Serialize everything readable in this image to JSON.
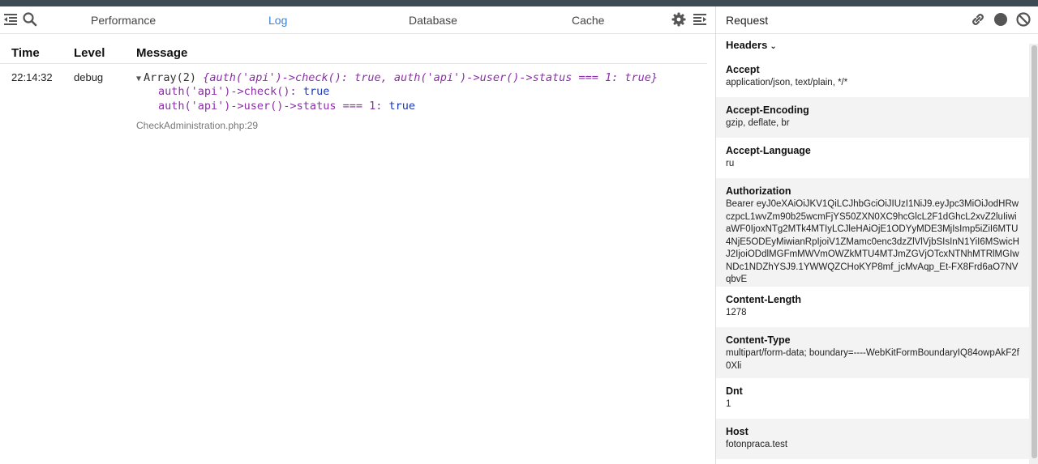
{
  "toolbar": {
    "tabs": [
      {
        "label": "Performance",
        "active": false
      },
      {
        "label": "Log",
        "active": true
      },
      {
        "label": "Database",
        "active": false
      },
      {
        "label": "Cache",
        "active": false
      }
    ],
    "icons": [
      "collapse-panel-icon",
      "search-icon",
      "gear-icon",
      "expand-panel-icon"
    ]
  },
  "log": {
    "columns": [
      "Time",
      "Level",
      "Message"
    ],
    "rows": [
      {
        "time": "22:14:32",
        "level": "debug",
        "array_label": "Array(2)",
        "preview": "{auth('api')->check(): true, auth('api')->user()->status === 1: true}",
        "props": [
          {
            "key": "auth('api')->check():",
            "value": "true"
          },
          {
            "key": "auth('api')->user()->status === 1:",
            "value": "true"
          }
        ],
        "file": "CheckAdministration.php:29"
      }
    ]
  },
  "request": {
    "title": "Request",
    "icons": [
      "link-icon",
      "record-icon",
      "clear-icon"
    ],
    "section": "Headers",
    "headers": [
      {
        "name": "Accept",
        "value": "application/json, text/plain, */*"
      },
      {
        "name": "Accept-Encoding",
        "value": "gzip, deflate, br"
      },
      {
        "name": "Accept-Language",
        "value": "ru"
      },
      {
        "name": "Authorization",
        "value": "Bearer eyJ0eXAiOiJKV1QiLCJhbGciOiJIUzI1NiJ9.eyJpc3MiOiJodHRwczpcL1wvZm90b25wcmFjYS50ZXN0XC9hcGlcL2F1dGhcL2xvZ2luIiwiaWF0IjoxNTg2MTk4MTIyLCJleHAiOjE1ODYyMDE3MjIsImp5iZiI6MTU4NjE5ODEyMiwianRpIjoiV1ZMamc0enc3dzZlVlVjbSIsInN1YiI6MSwicHJ2IjoiODdlMGFmMWVmOWZkMTU4MTJmZGVjOTcxNTNhMTRlMGIwNDc1NDZhYSJ9.1YWWQZCHoKYP8mf_jcMvAqp_Et-FX8Frd6aO7NVqbvE"
      },
      {
        "name": "Content-Length",
        "value": "1278"
      },
      {
        "name": "Content-Type",
        "value": "multipart/form-data; boundary=----WebKitFormBoundaryIQ84owpAkF2f0Xli"
      },
      {
        "name": "Dnt",
        "value": "1"
      },
      {
        "name": "Host",
        "value": "fotonpraca.test"
      }
    ]
  },
  "colors": {
    "accent": "#3b82d6",
    "top_bar": "#3f4b52",
    "preview_text": "#8b2fa8",
    "value_text": "#1c35b8"
  }
}
